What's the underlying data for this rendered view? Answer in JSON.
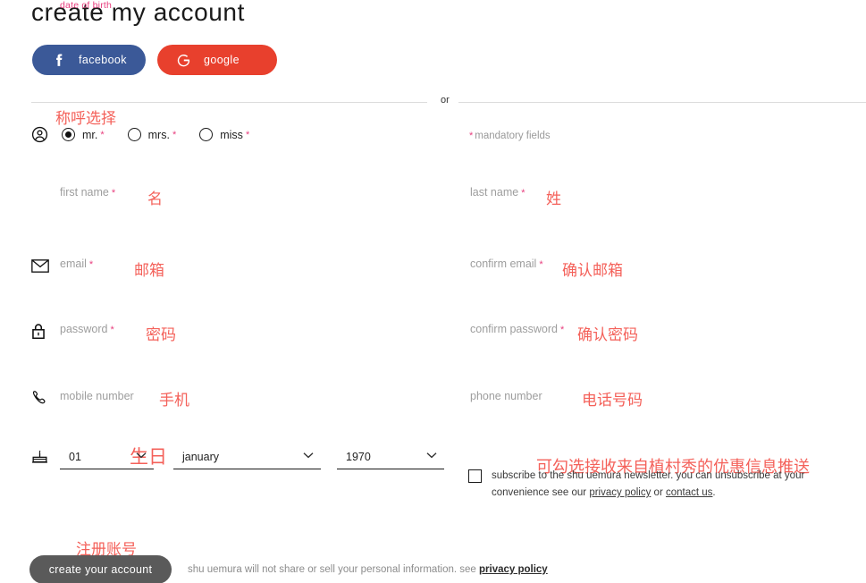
{
  "page": {
    "title": "create my account",
    "or_label": "or",
    "mandatory_note": "mandatory fields",
    "star": "*"
  },
  "social": {
    "facebook": {
      "label": "facebook",
      "icon": "facebook-icon",
      "color": "#3b5998"
    },
    "google": {
      "label": "google",
      "icon": "google-icon",
      "color": "#e8402d"
    }
  },
  "gender": {
    "icon": "user-circle-icon",
    "annotation": "称呼选择",
    "options": [
      {
        "label": "mr.",
        "required": true,
        "selected": true
      },
      {
        "label": "mrs.",
        "required": true,
        "selected": false
      },
      {
        "label": "miss",
        "required": true,
        "selected": false
      }
    ]
  },
  "fields": {
    "first_name": {
      "label": "first name",
      "value": "",
      "placeholder": "first name",
      "required": true,
      "annotation": "名"
    },
    "last_name": {
      "label": "last name",
      "value": "",
      "placeholder": "last name",
      "required": true,
      "annotation": "姓"
    },
    "email": {
      "label": "email",
      "value": "",
      "placeholder": "email",
      "required": true,
      "annotation": "邮箱",
      "icon": "envelope-icon"
    },
    "confirm_email": {
      "label": "confirm email",
      "value": "",
      "placeholder": "confirm email",
      "required": true,
      "annotation": "确认邮箱"
    },
    "password": {
      "label": "password",
      "value": "",
      "placeholder": "password",
      "required": true,
      "annotation": "密码",
      "icon": "lock-icon"
    },
    "confirm_password": {
      "label": "confirm password",
      "value": "",
      "placeholder": "confirm password",
      "required": true,
      "annotation": "确认密码"
    },
    "mobile_number": {
      "label": "mobile number",
      "value": "",
      "placeholder": "mobile number",
      "required": false,
      "annotation": "手机",
      "icon": "phone-icon"
    },
    "phone_number": {
      "label": "phone number",
      "value": "",
      "placeholder": "phone number",
      "required": false,
      "annotation": "电话号码"
    }
  },
  "date_of_birth": {
    "label": "date of birth",
    "annotation": "生日",
    "icon": "birthday-cake-icon",
    "day": {
      "value": "01"
    },
    "month": {
      "value": "january"
    },
    "year": {
      "value": "1970"
    }
  },
  "newsletter": {
    "checked": false,
    "annotation": "可勾选接收来自植村秀的优惠信息推送",
    "text_part1": "subscribe to the shu uemura newsletter. you can unsubscribe at your convenience see our ",
    "link_privacy": "privacy policy",
    "text_part2": " or ",
    "link_contact": "contact us",
    "text_part3": "."
  },
  "submit": {
    "label": "create your account",
    "annotation": "注册账号",
    "legal_text": "shu uemura will not share or sell your personal information. see ",
    "legal_link": "privacy policy"
  },
  "colors": {
    "accent_pink": "#e8407f",
    "annotation_red": "#f4615a",
    "facebook_blue": "#3b5998",
    "google_red": "#e8402d",
    "submit_gray": "#5a5a5a"
  }
}
